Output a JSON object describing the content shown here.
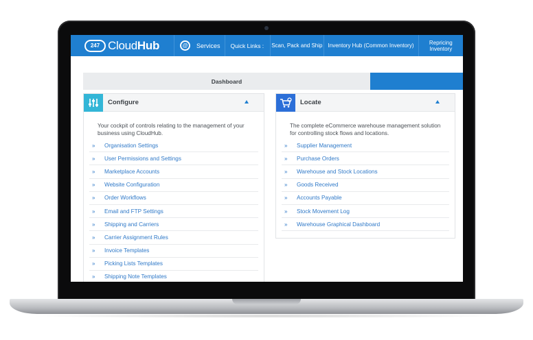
{
  "topbar": {
    "logo_number": "247",
    "logo_text_light": "Cloud",
    "logo_text_bold": "Hub",
    "services_label": "Services",
    "quick_links_label": "Quick Links :",
    "quick_links": [
      "Scan, Pack and Ship",
      "Inventory Hub (Common Inventory)",
      "Repricing Inventory"
    ]
  },
  "tabs": {
    "dashboard_label": "Dashboard"
  },
  "configure": {
    "title": "Configure",
    "icon": "sliders-icon",
    "description": "Your cockpit of controls relating to the management of your business using CloudHub.",
    "links": [
      "Organisation Settings",
      "User Permissions and Settings",
      "Marketplace Accounts",
      "Website Configuration",
      "Order Workflows",
      "Email and FTP Settings",
      "Shipping and Carriers",
      "Carrier Assignment Rules",
      "Invoice Templates",
      "Picking Lists Templates",
      "Shipping Note Templates"
    ]
  },
  "locate": {
    "title": "Locate",
    "icon": "cart-search-icon",
    "description": "The complete eCommerce warehouse management solution for controlling stock flows and locations.",
    "links": [
      "Supplier Management",
      "Purchase Orders",
      "Warehouse and Stock Locations",
      "Goods Received",
      "Accounts Payable",
      "Stock Movement Log",
      "Warehouse Graphical Dashboard"
    ]
  },
  "colors": {
    "brand_blue": "#1f7fd0",
    "configure_icon_bg": "#33b6d7",
    "locate_icon_bg": "#2c6fd8",
    "link_color": "#2f79c8"
  }
}
